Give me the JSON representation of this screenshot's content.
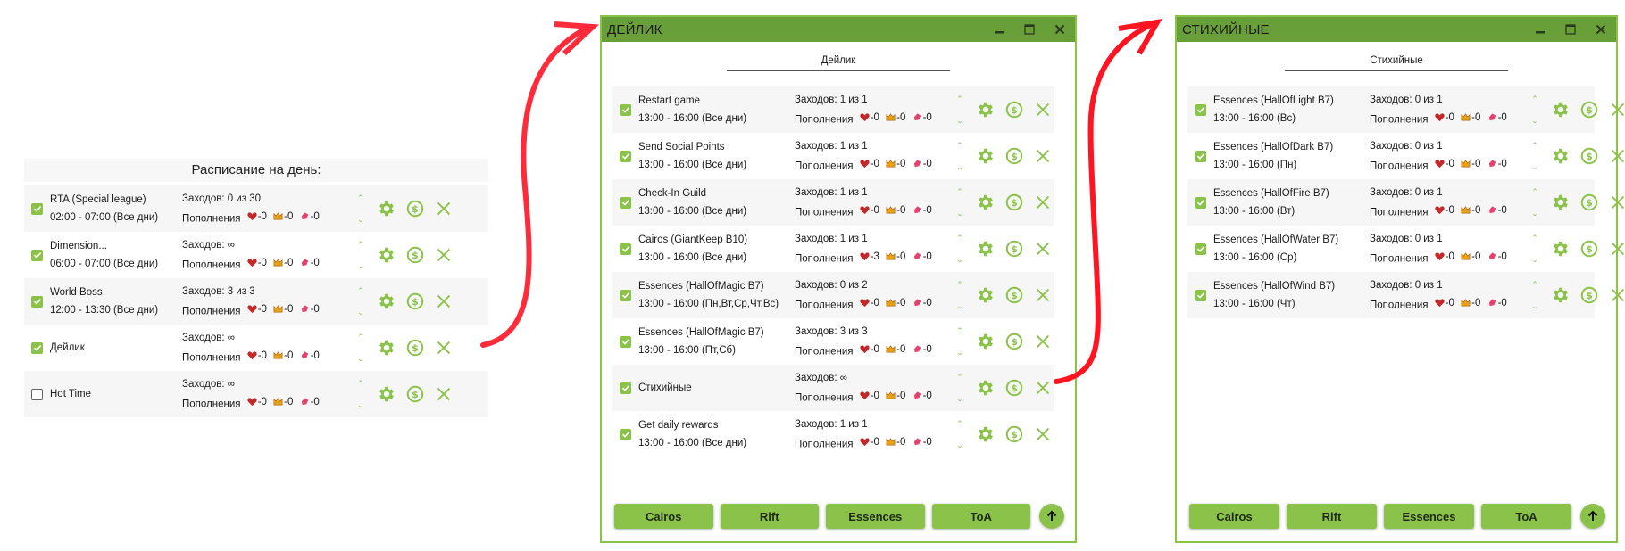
{
  "day_panel": {
    "title": "Расписание на день:",
    "rows": [
      {
        "checked": true,
        "name": "RTA (Special league)",
        "time": "02:00  -  07:00 (Все дни)",
        "runs": "Заходов: 0 из 30",
        "refills_label": "Пополнения",
        "hearts": "-0",
        "crowns": "-0",
        "crystals": "-0"
      },
      {
        "checked": true,
        "name": "Dimension...",
        "time": "06:00  -  07:00 (Все дни)",
        "runs": "Заходов: ∞",
        "refills_label": "Пополнения",
        "hearts": "-0",
        "crowns": "-0",
        "crystals": "-0"
      },
      {
        "checked": true,
        "name": "World Boss",
        "time": "12:00  -  13:30 (Все дни)",
        "runs": "Заходов: 3 из 3",
        "refills_label": "Пополнения",
        "hearts": "-0",
        "crowns": "-0",
        "crystals": "-0"
      },
      {
        "checked": true,
        "name": "Дейлик",
        "time": "",
        "runs": "Заходов: ∞",
        "refills_label": "Пополнения",
        "hearts": "-0",
        "crowns": "-0",
        "crystals": "-0"
      },
      {
        "checked": false,
        "name": "Hot Time",
        "time": "",
        "runs": "Заходов: ∞",
        "refills_label": "Пополнения",
        "hearts": "-0",
        "crowns": "-0",
        "crystals": "-0"
      }
    ]
  },
  "windows": [
    {
      "title": "ДЕЙЛИК",
      "subtitle": "Дейлик",
      "rows": [
        {
          "checked": true,
          "name": "Restart game",
          "time": "13:00  -  16:00 (Все дни)",
          "runs": "Заходов: 1 из 1",
          "refills_label": "Пополнения",
          "hearts": "-0",
          "crowns": "-0",
          "crystals": "-0"
        },
        {
          "checked": true,
          "name": "Send Social Points",
          "time": "13:00  -  16:00 (Все дни)",
          "runs": "Заходов: 1 из 1",
          "refills_label": "Пополнения",
          "hearts": "-0",
          "crowns": "-0",
          "crystals": "-0"
        },
        {
          "checked": true,
          "name": "Check-In Guild",
          "time": "13:00  -  16:00 (Все дни)",
          "runs": "Заходов: 1 из 1",
          "refills_label": "Пополнения",
          "hearts": "-0",
          "crowns": "-0",
          "crystals": "-0"
        },
        {
          "checked": true,
          "name": "Cairos (GiantKeep B10)",
          "time": "13:00  -  16:00 (Все дни)",
          "runs": "Заходов: 1 из 1",
          "refills_label": "Пополнения",
          "hearts": "-3",
          "crowns": "-0",
          "crystals": "-0"
        },
        {
          "checked": true,
          "name": "Essences (HallOfMagic B7)",
          "time": "13:00  -  16:00 (Пн,Вт,Ср,Чт,Вс)",
          "runs": "Заходов: 0 из 2",
          "refills_label": "Пополнения",
          "hearts": "-0",
          "crowns": "-0",
          "crystals": "-0"
        },
        {
          "checked": true,
          "name": "Essences (HallOfMagic B7)",
          "time": "13:00  -  16:00 (Пт,Сб)",
          "runs": "Заходов: 3 из 3",
          "refills_label": "Пополнения",
          "hearts": "-0",
          "crowns": "-0",
          "crystals": "-0"
        },
        {
          "checked": true,
          "name": "Стихийные",
          "time": "",
          "runs": "Заходов: ∞",
          "refills_label": "Пополнения",
          "hearts": "-0",
          "crowns": "-0",
          "crystals": "-0"
        },
        {
          "checked": true,
          "name": "Get daily rewards",
          "time": "13:00  -  16:00 (Все дни)",
          "runs": "Заходов: 1 из 1",
          "refills_label": "Пополнения",
          "hearts": "-0",
          "crowns": "-0",
          "crystals": "-0"
        }
      ],
      "footer_buttons": [
        "Cairos",
        "Rift",
        "Essences",
        "ToA"
      ]
    },
    {
      "title": "СТИХИЙНЫЕ",
      "subtitle": "Стихийные",
      "rows": [
        {
          "checked": true,
          "name": "Essences (HallOfLight B7)",
          "time": "13:00  -  16:00 (Вс)",
          "runs": "Заходов: 0 из 1",
          "refills_label": "Пополнения",
          "hearts": "-0",
          "crowns": "-0",
          "crystals": "-0"
        },
        {
          "checked": true,
          "name": "Essences (HallOfDark B7)",
          "time": "13:00  -  16:00 (Пн)",
          "runs": "Заходов: 0 из 1",
          "refills_label": "Пополнения",
          "hearts": "-0",
          "crowns": "-0",
          "crystals": "-0"
        },
        {
          "checked": true,
          "name": "Essences (HallOfFire B7)",
          "time": "13:00  -  16:00 (Вт)",
          "runs": "Заходов: 0 из 1",
          "refills_label": "Пополнения",
          "hearts": "-0",
          "crowns": "-0",
          "crystals": "-0"
        },
        {
          "checked": true,
          "name": "Essences (HallOfWater B7)",
          "time": "13:00  -  16:00 (Ср)",
          "runs": "Заходов: 0 из 1",
          "refills_label": "Пополнения",
          "hearts": "-0",
          "crowns": "-0",
          "crystals": "-0"
        },
        {
          "checked": true,
          "name": "Essences (HallOfWind B7)",
          "time": "13:00  -  16:00 (Чт)",
          "runs": "Заходов: 0 из 1",
          "refills_label": "Пополнения",
          "hearts": "-0",
          "crowns": "-0",
          "crystals": "-0"
        }
      ],
      "footer_buttons": [
        "Cairos",
        "Rift",
        "Essences",
        "ToA"
      ]
    }
  ],
  "icons": {
    "order_up": "^",
    "order_down": "v",
    "settings": "gear-icon",
    "refill": "dollar-circle-icon",
    "delete": "close-x-icon",
    "scroll_top": "arrow-up-icon"
  },
  "colors": {
    "accent": "#8bc34a",
    "titlebar": "#689f38",
    "annotation_arrow": "#ff1f2d"
  }
}
